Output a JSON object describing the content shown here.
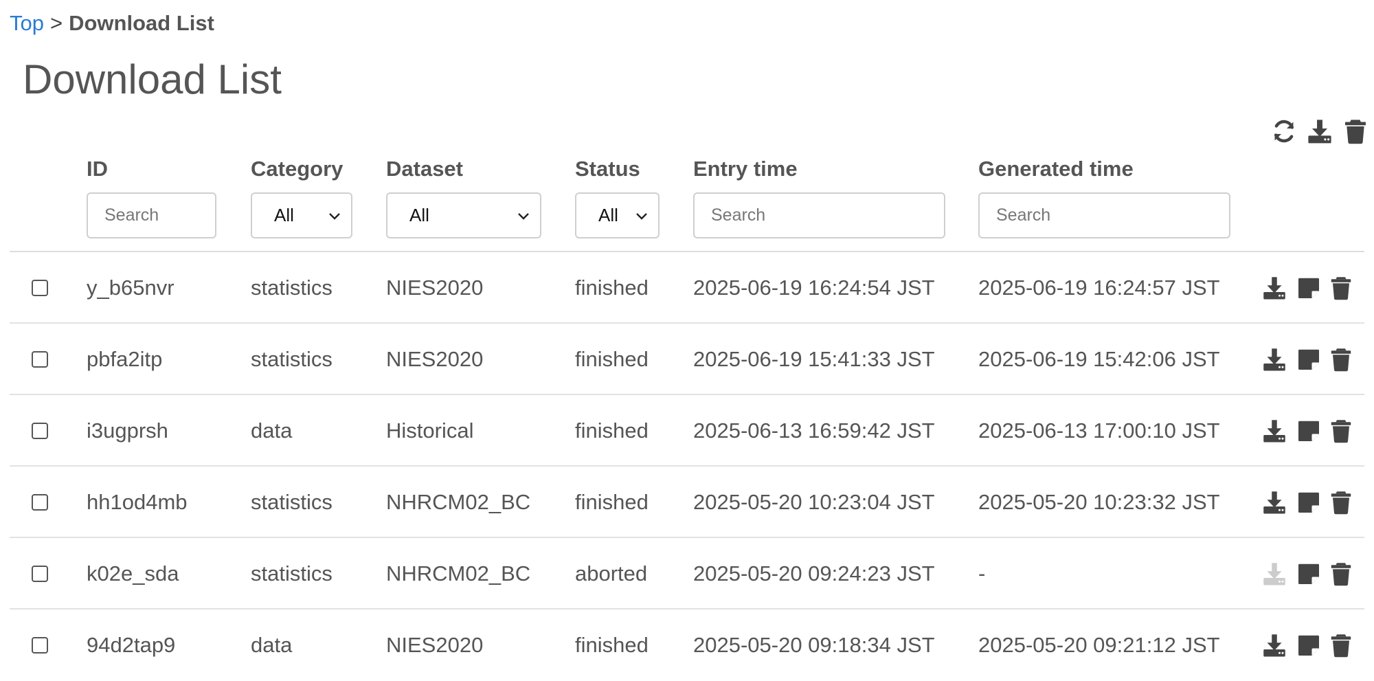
{
  "breadcrumb": {
    "home": "Top",
    "separator": ">",
    "current": "Download List"
  },
  "page": {
    "title": "Download List"
  },
  "toolbar": {
    "icons": [
      "refresh-icon",
      "download-icon",
      "trash-icon"
    ]
  },
  "columns": {
    "id": "ID",
    "category": "Category",
    "dataset": "Dataset",
    "status": "Status",
    "entry_time": "Entry time",
    "generated_time": "Generated time"
  },
  "filters": {
    "id_placeholder": "Search",
    "category_value": "All",
    "dataset_value": "All",
    "status_value": "All",
    "entry_time_placeholder": "Search",
    "generated_time_placeholder": "Search"
  },
  "rows": [
    {
      "id": "y_b65nvr",
      "category": "statistics",
      "dataset": "NIES2020",
      "status": "finished",
      "entry_time": "2025-06-19 16:24:54 JST",
      "generated_time": "2025-06-19 16:24:57 JST",
      "download_enabled": true
    },
    {
      "id": "pbfa2itp",
      "category": "statistics",
      "dataset": "NIES2020",
      "status": "finished",
      "entry_time": "2025-06-19 15:41:33 JST",
      "generated_time": "2025-06-19 15:42:06 JST",
      "download_enabled": true
    },
    {
      "id": "i3ugprsh",
      "category": "data",
      "dataset": "Historical",
      "status": "finished",
      "entry_time": "2025-06-13 16:59:42 JST",
      "generated_time": "2025-06-13 17:00:10 JST",
      "download_enabled": true
    },
    {
      "id": "hh1od4mb",
      "category": "statistics",
      "dataset": "NHRCM02_BC",
      "status": "finished",
      "entry_time": "2025-05-20 10:23:04 JST",
      "generated_time": "2025-05-20 10:23:32 JST",
      "download_enabled": true
    },
    {
      "id": "k02e_sda",
      "category": "statistics",
      "dataset": "NHRCM02_BC",
      "status": "aborted",
      "entry_time": "2025-05-20 09:24:23 JST",
      "generated_time": "-",
      "download_enabled": false
    },
    {
      "id": "94d2tap9",
      "category": "data",
      "dataset": "NIES2020",
      "status": "finished",
      "entry_time": "2025-05-20 09:18:34 JST",
      "generated_time": "2025-05-20 09:21:12 JST",
      "download_enabled": true
    }
  ],
  "colors": {
    "link": "#2a7bd4",
    "text": "#555555",
    "icon": "#444444",
    "icon_disabled": "#cccccc",
    "border": "#cfcfcf"
  }
}
